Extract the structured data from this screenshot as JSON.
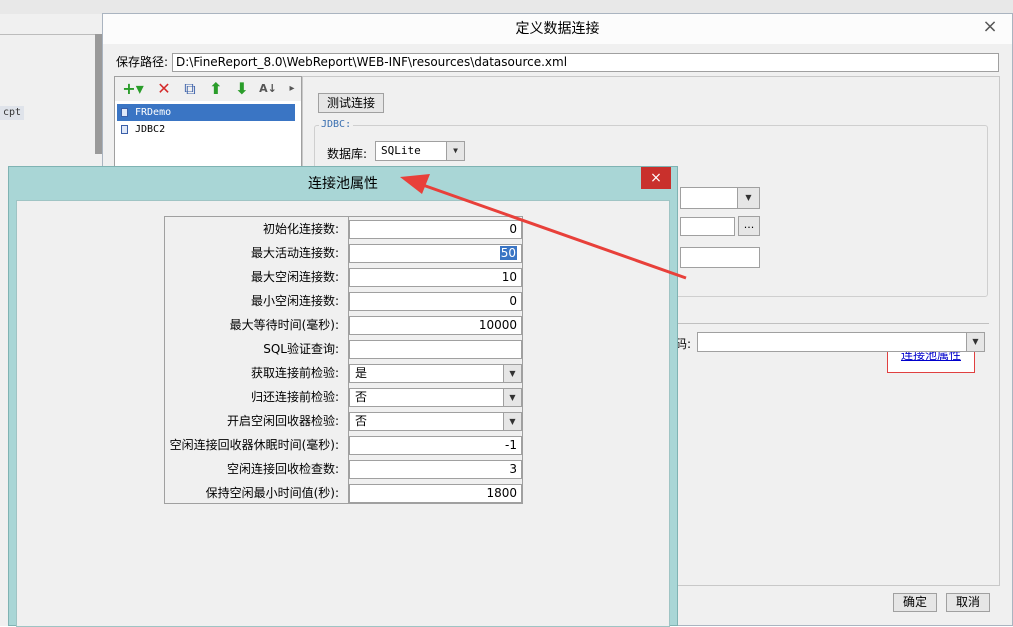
{
  "background": {
    "file_tag": "cpt"
  },
  "main_dialog": {
    "title": "定义数据连接",
    "close_glyph": "×",
    "save_path_label": "保存路径:",
    "save_path_value": "D:\\FineReport_8.0\\WebReport\\WEB-INF\\resources\\datasource.xml",
    "toolbar": {
      "add": "+▾",
      "delete": "✕",
      "copy": "⧉",
      "up": "⬆",
      "down": "⬇",
      "sort": "A↓",
      "more": "▸"
    },
    "connections": [
      "FRDemo",
      "JDBC2"
    ],
    "test_button": "测试连接",
    "jdbc_legend": "JDBC:",
    "database_label": "数据库:",
    "database_value": "SQLite",
    "browse_button": "...",
    "pool_link": "连接池属性",
    "encoding_label_fragment": "码:",
    "ok_button": "确定",
    "cancel_button": "取消"
  },
  "pool_dialog": {
    "title": "连接池属性",
    "close_glyph": "×",
    "rows": [
      {
        "label": "初始化连接数:",
        "value": "0",
        "kind": "text"
      },
      {
        "label": "最大活动连接数:",
        "value": "50",
        "kind": "text-selected"
      },
      {
        "label": "最大空闲连接数:",
        "value": "10",
        "kind": "text"
      },
      {
        "label": "最小空闲连接数:",
        "value": "0",
        "kind": "text"
      },
      {
        "label": "最大等待时间(毫秒):",
        "value": "10000",
        "kind": "text"
      },
      {
        "label": "SQL验证查询:",
        "value": "",
        "kind": "text"
      },
      {
        "label": "获取连接前检验:",
        "value": "是",
        "kind": "select"
      },
      {
        "label": "归还连接前检验:",
        "value": "否",
        "kind": "select"
      },
      {
        "label": "开启空闲回收器检验:",
        "value": "否",
        "kind": "select"
      },
      {
        "label": "空闲连接回收器休眠时间(毫秒):",
        "value": "-1",
        "kind": "text"
      },
      {
        "label": "空闲连接回收检查数:",
        "value": "3",
        "kind": "text"
      },
      {
        "label": "保持空闲最小时间值(秒):",
        "value": "1800",
        "kind": "text"
      }
    ]
  },
  "colors": {
    "pool_titlebar": "#a9d6d6",
    "close_red": "#c9302c",
    "annotation_arrow": "#e8403a",
    "link": "#0000cc"
  },
  "icons": [
    "add-icon",
    "delete-icon",
    "copy-icon",
    "move-up-icon",
    "move-down-icon",
    "sort-icon",
    "dropdown-arrow-icon",
    "close-icon",
    "connection-icon"
  ]
}
